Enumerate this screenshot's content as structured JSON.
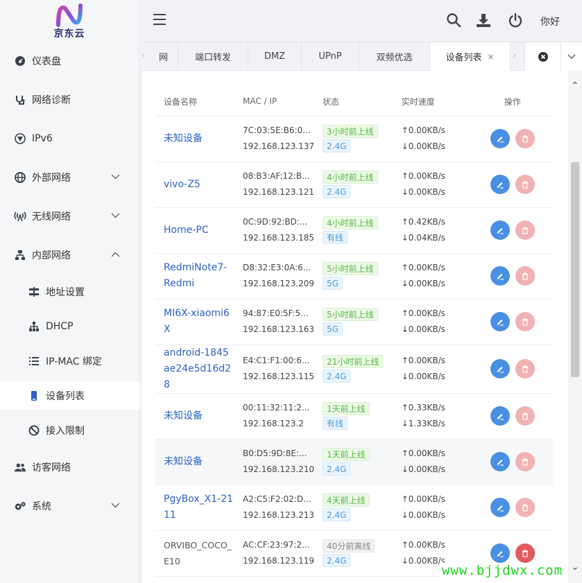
{
  "brand": {
    "logo_text": "京东云"
  },
  "sidebar": {
    "items": [
      {
        "label": "仪表盘",
        "icon": "dashboard-icon"
      },
      {
        "label": "网络诊断",
        "icon": "stethoscope-icon"
      },
      {
        "label": "IPv6",
        "icon": "ipv6-icon"
      },
      {
        "label": "外部网络",
        "icon": "globe-icon",
        "expandable": "collapsed"
      },
      {
        "label": "无线网络",
        "icon": "wireless-icon",
        "expandable": "collapsed"
      },
      {
        "label": "内部网络",
        "icon": "lan-icon",
        "expandable": "expanded"
      },
      {
        "label": "地址设置",
        "icon": "address-icon",
        "sub": true
      },
      {
        "label": "DHCP",
        "icon": "dhcp-icon",
        "sub": true
      },
      {
        "label": "IP-MAC 绑定",
        "icon": "list-icon",
        "sub": true
      },
      {
        "label": "设备列表",
        "icon": "device-icon",
        "sub": true,
        "active": true
      },
      {
        "label": "接入限制",
        "icon": "ban-icon",
        "sub": true
      },
      {
        "label": "访客网络",
        "icon": "guests-icon"
      },
      {
        "label": "系统",
        "icon": "gears-icon",
        "expandable": "collapsed"
      }
    ]
  },
  "header": {
    "greeting": "你好"
  },
  "tabs": [
    {
      "label": "网"
    },
    {
      "label": "端口转发"
    },
    {
      "label": "DMZ"
    },
    {
      "label": "UPnP"
    },
    {
      "label": "双频优选"
    },
    {
      "label": "设备列表",
      "active": true,
      "close": "×"
    }
  ],
  "table": {
    "headers": [
      "设备名称",
      "MAC / IP",
      "状态",
      "实时速度",
      "操作"
    ],
    "rows": [
      {
        "name": "未知设备",
        "mac": "7C:03:5E:B6:0...",
        "ip": "192.168.123.137",
        "status": "3小时前上线",
        "net": "2.4G",
        "up": "↑0.00KB/s",
        "down": "↓0.00KB/s",
        "online": true
      },
      {
        "name": "vivo-Z5",
        "mac": "08:B3:AF:12:B...",
        "ip": "192.168.123.121",
        "status": "4小时前上线",
        "net": "2.4G",
        "up": "↑0.00KB/s",
        "down": "↓0.00KB/s",
        "online": true
      },
      {
        "name": "Home-PC",
        "mac": "0C:9D:92:BD:...",
        "ip": "192.168.123.185",
        "status": "4小时前上线",
        "net": "有线",
        "up": "↑0.42KB/s",
        "down": "↓0.04KB/s",
        "online": true
      },
      {
        "name": "RedmiNote7-Redmi",
        "mac": "D8:32:E3:0A:6...",
        "ip": "192.168.123.209",
        "status": "5小时前上线",
        "net": "5G",
        "up": "↑0.00KB/s",
        "down": "↓0.00KB/s",
        "online": true
      },
      {
        "name": "MI6X-xiaomi6X",
        "mac": "94:87:E0:5F:5...",
        "ip": "192.168.123.163",
        "status": "5小时前上线",
        "net": "5G",
        "up": "↑0.00KB/s",
        "down": "↓0.00KB/s",
        "online": true
      },
      {
        "name": "android-1845ae24e5d16d28",
        "mac": "E4:C1:F1:00:6...",
        "ip": "192.168.123.115",
        "status": "21小时前上线",
        "net": "2.4G",
        "up": "↑0.00KB/s",
        "down": "↓0.00KB/s",
        "online": true
      },
      {
        "name": "未知设备",
        "mac": "00:11:32:11:2...",
        "ip": "192.168.123.2",
        "status": "1天前上线",
        "net": "有线",
        "up": "↑0.33KB/s",
        "down": "↓1.33KB/s",
        "online": true
      },
      {
        "name": "未知设备",
        "mac": "B0:D5:9D:8E:...",
        "ip": "192.168.123.210",
        "status": "1天前上线",
        "net": "2.4G",
        "up": "↑0.00KB/s",
        "down": "↓0.00KB/s",
        "online": true,
        "highlight": true
      },
      {
        "name": "PgyBox_X1-2111",
        "mac": "A2:C5:F2:02:D...",
        "ip": "192.168.123.213",
        "status": "4天前上线",
        "net": "2.4G",
        "up": "↑0.00KB/s",
        "down": "↓0.00KB/s",
        "online": true
      },
      {
        "name": "ORVIBO_COCO_E10",
        "mac": "AC:CF:23:97:2...",
        "ip": "192.168.123.119",
        "status": "40分前离线",
        "net": "2.4G",
        "up": "↑0.00KB/s",
        "down": "↓0.00KB/s",
        "online": false
      }
    ]
  },
  "watermark": "www.bjjdwx.com",
  "colors": {
    "link": "#2d62c4",
    "online": "#57b64a",
    "edit": "#4a90e2",
    "delete": "#e25b5b"
  }
}
